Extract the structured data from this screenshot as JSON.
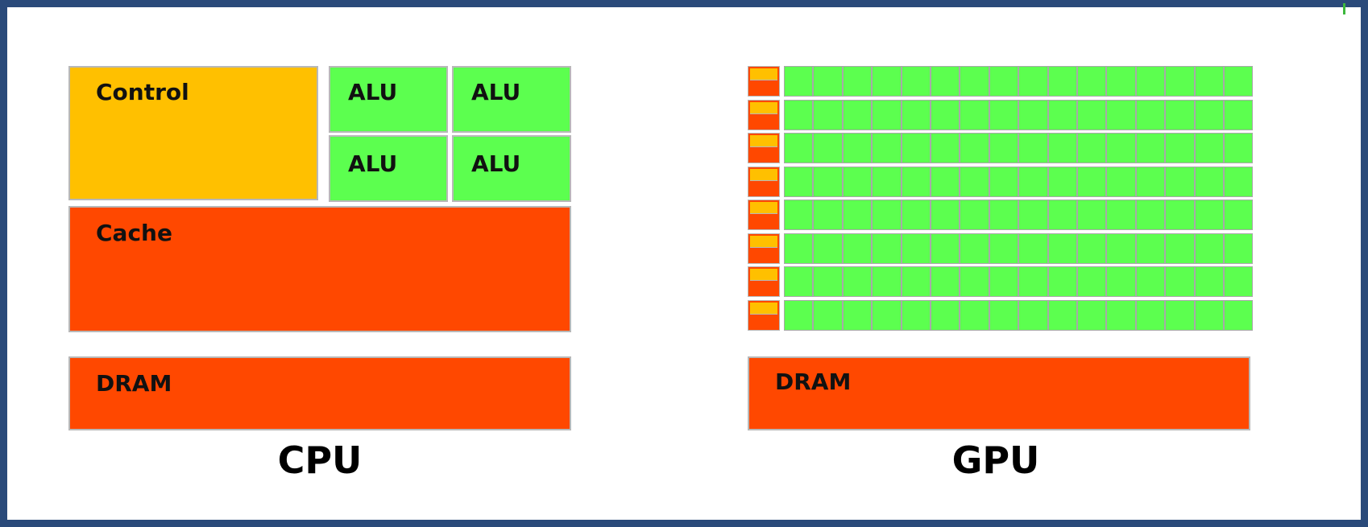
{
  "colors": {
    "control": "#ffc000",
    "alu": "#5cff4f",
    "cache": "#ff4800",
    "dram": "#ff4800",
    "frame": "#2a4a7a",
    "tick": "#3cb83c"
  },
  "cpu": {
    "title": "CPU",
    "control_label": "Control",
    "alu_labels": [
      "ALU",
      "ALU",
      "ALU",
      "ALU"
    ],
    "cache_label": "Cache",
    "dram_label": "DRAM"
  },
  "gpu": {
    "title": "GPU",
    "dram_label": "DRAM",
    "rows": 8,
    "alus_per_row": 16
  }
}
